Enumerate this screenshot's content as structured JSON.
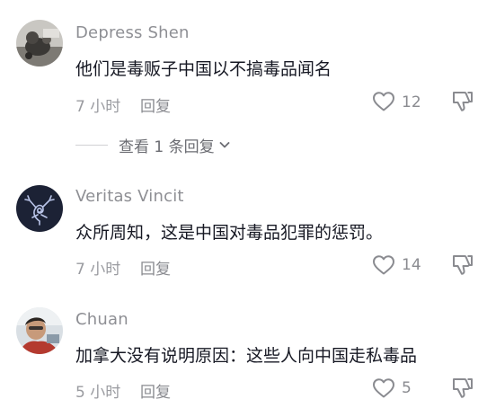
{
  "comments": [
    {
      "username": "Depress Shen",
      "text": "他们是毒贩子中国以不搞毒品闻名",
      "time": "7 小时",
      "reply": "回复",
      "likes": "12"
    },
    {
      "username": "Veritas Vincit",
      "text": "众所周知，这是中国对毒品犯罪的惩罚。",
      "time": "7 小时",
      "reply": "回复",
      "likes": "14"
    },
    {
      "username": "Chuan",
      "text": "加拿大没有说明原因：这些人向中国走私毒品",
      "time": "5 小时",
      "reply": "回复",
      "likes": "5"
    }
  ],
  "view_replies": "查看 1 条回复",
  "icons": {
    "like": "heart-outline-icon",
    "dislike": "thumbs-down-outline-icon",
    "expand": "chevron-down-icon"
  },
  "colors": {
    "text_primary": "#161823",
    "text_secondary": "#8e8f94",
    "icon": "#8a8b90"
  }
}
